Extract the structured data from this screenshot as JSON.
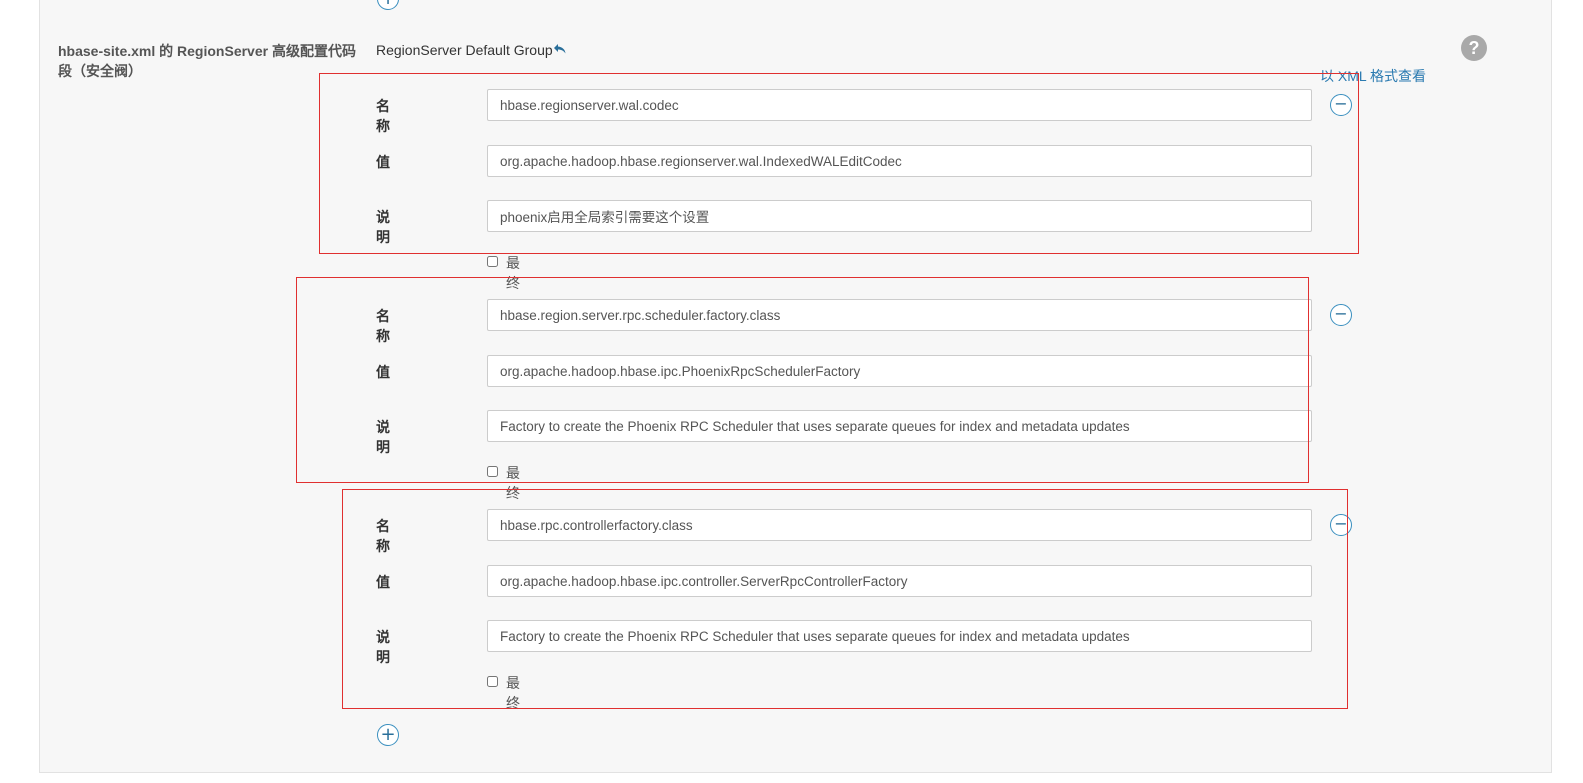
{
  "property": {
    "label": "hbase-site.xml 的 RegionServer 高级配置代码段（安全阀）",
    "group": "RegionServer Default Group",
    "view_as_xml": "以 XML 格式查看",
    "help_symbol": "?"
  },
  "buttons": {
    "add_symbol": "+",
    "remove_symbol": "−"
  },
  "field_labels": {
    "name": "名称",
    "value": "值",
    "description": "说明",
    "final": "最终"
  },
  "entries": [
    {
      "name": "hbase.regionserver.wal.codec",
      "value": "org.apache.hadoop.hbase.regionserver.wal.IndexedWALEditCodec",
      "description": "phoenix启用全局索引需要这个设置",
      "final": false
    },
    {
      "name": "hbase.region.server.rpc.scheduler.factory.class",
      "value": "org.apache.hadoop.hbase.ipc.PhoenixRpcSchedulerFactory",
      "description": "Factory to create the Phoenix RPC Scheduler that uses separate queues for index and metadata updates",
      "final": false
    },
    {
      "name": "hbase.rpc.controllerfactory.class",
      "value": "org.apache.hadoop.hbase.ipc.controller.ServerRpcControllerFactory",
      "description": "Factory to create the Phoenix RPC Scheduler that uses separate queues for index and metadata updates",
      "final": false
    }
  ],
  "colors": {
    "highlight_border": "#e03030",
    "link": "#2a7ab0",
    "panel_bg": "#f7f7f7"
  }
}
